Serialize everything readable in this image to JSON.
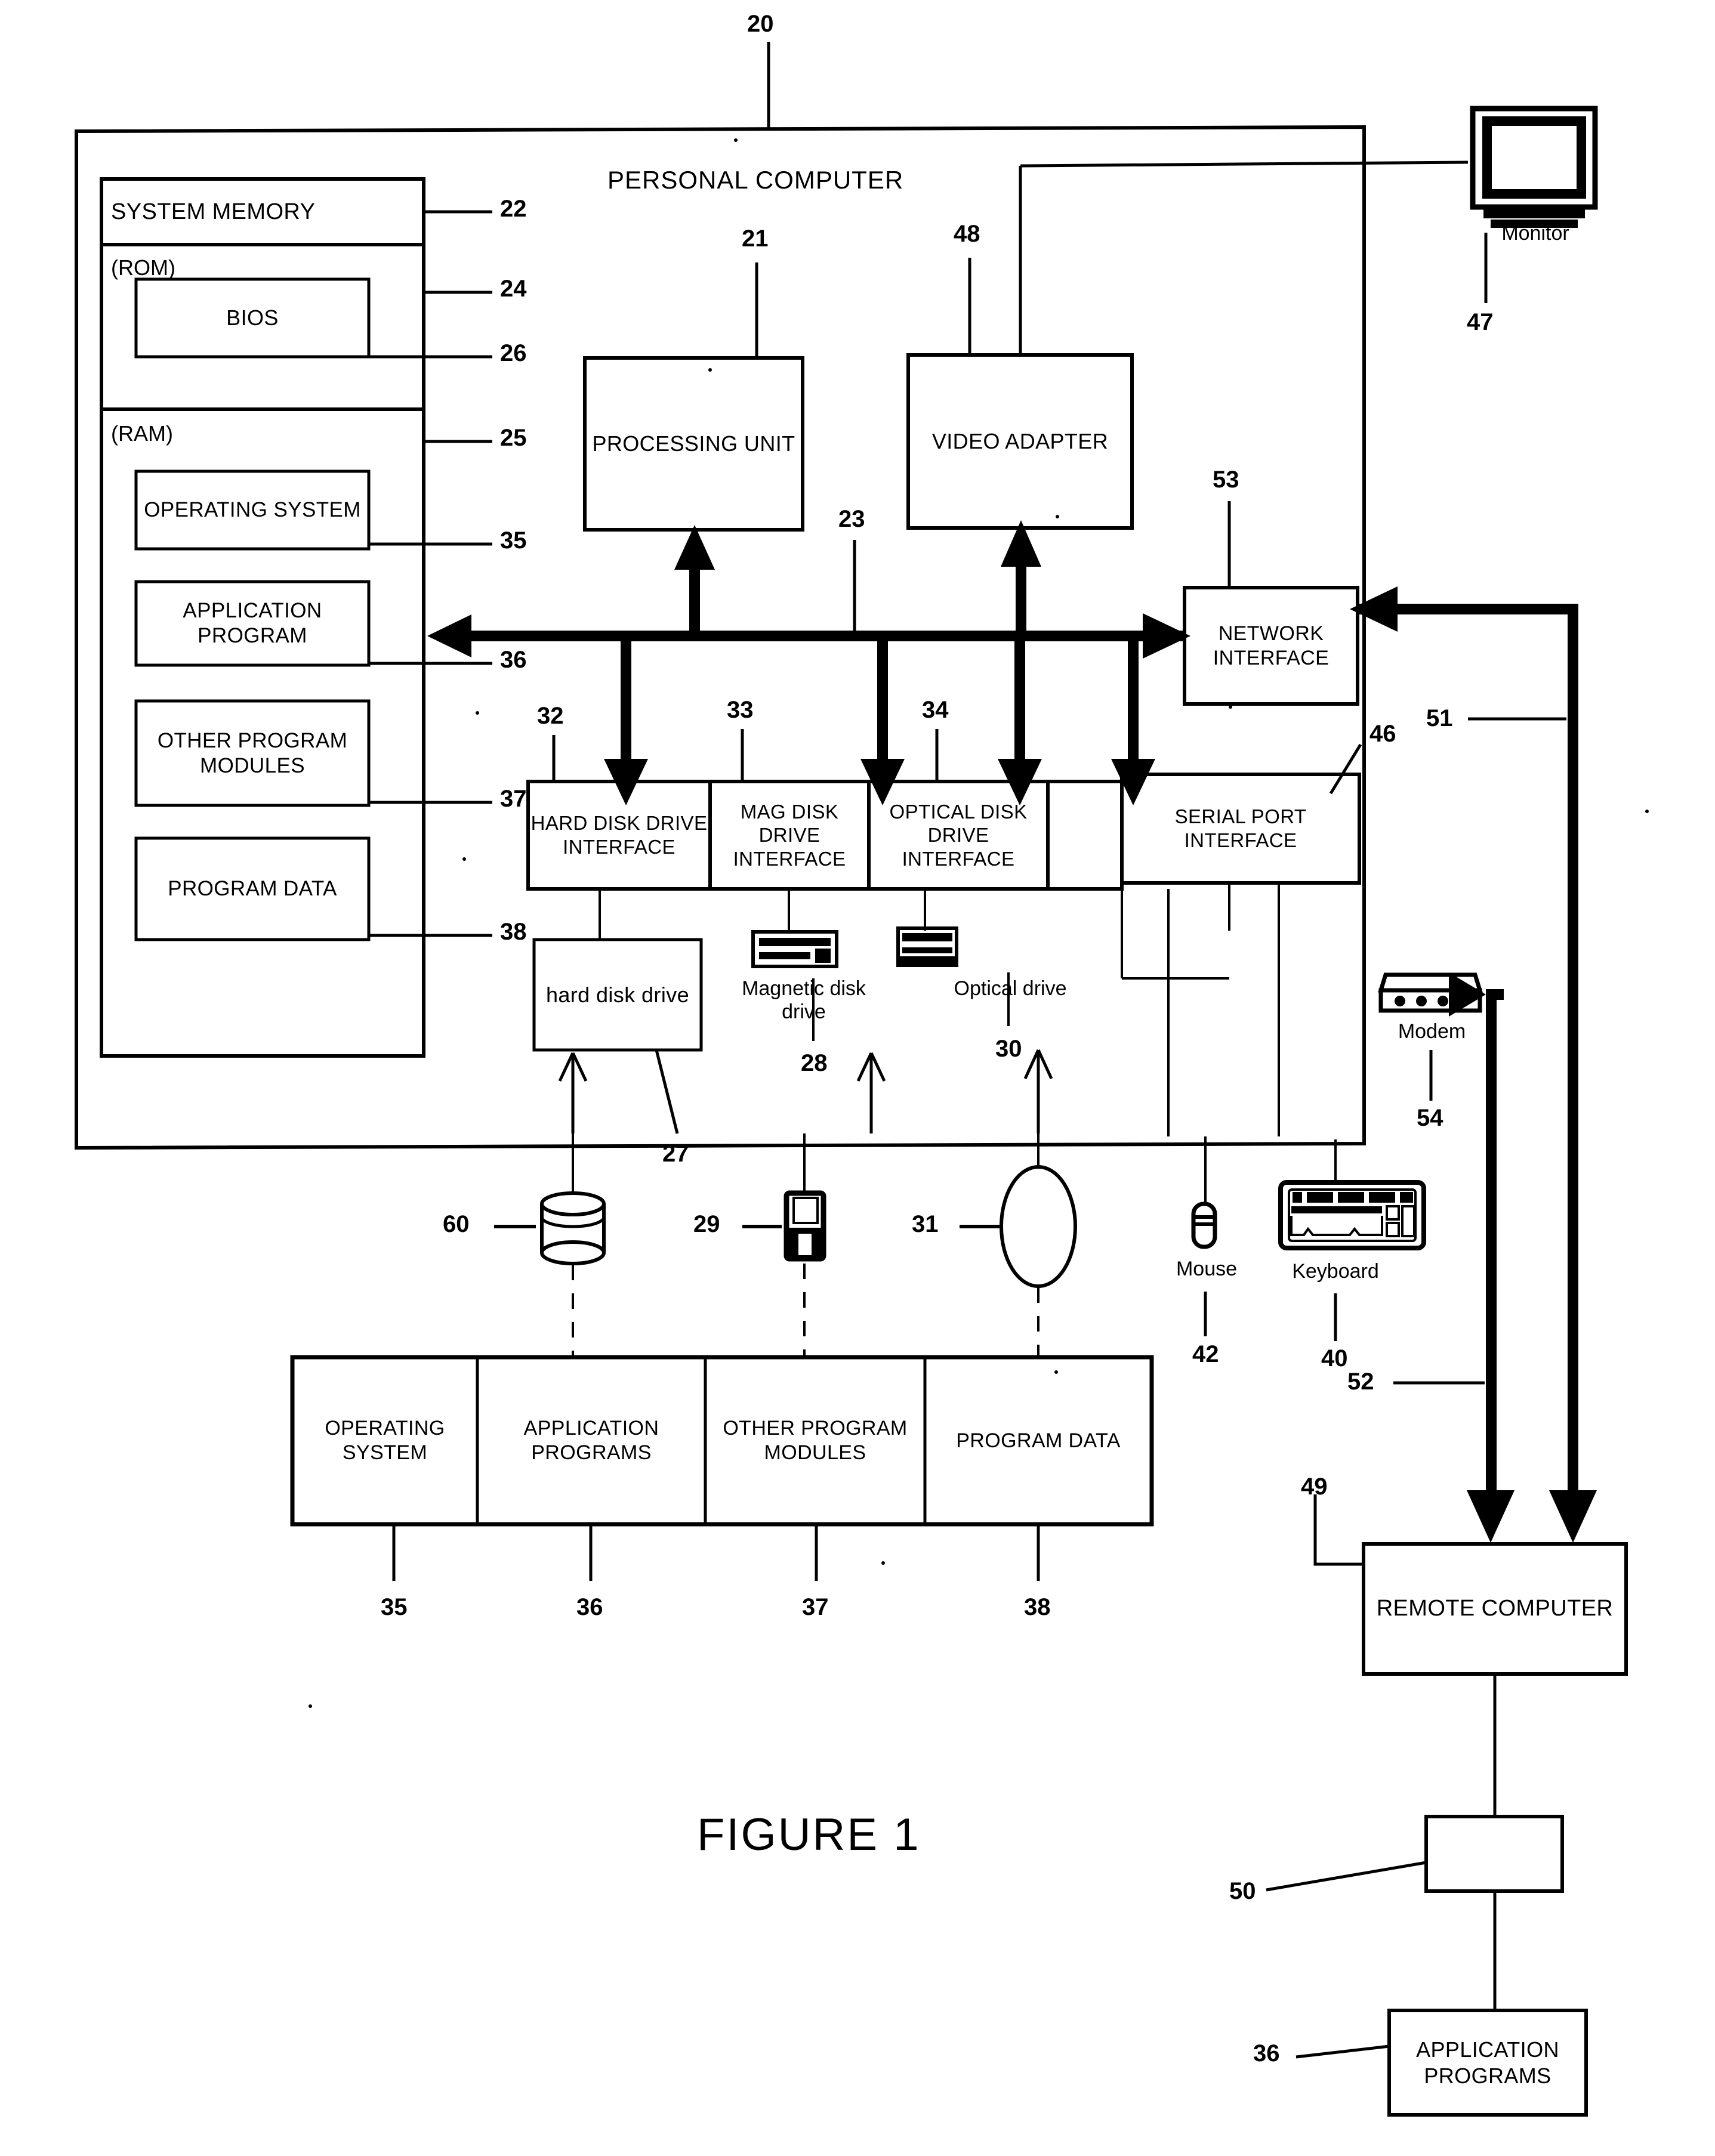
{
  "figure": {
    "caption": "FIGURE 1",
    "system_ref": "20",
    "title": "PERSONAL COMPUTER"
  },
  "memory": {
    "title": "SYSTEM MEMORY",
    "title_ref": "22",
    "rom_label": "(ROM)",
    "rom_ref": "24",
    "bios_label": "BIOS",
    "bios_ref": "26",
    "ram_label": "(RAM)",
    "ram_ref": "25",
    "items": [
      {
        "label": "OPERATING\nSYSTEM",
        "ref": "35"
      },
      {
        "label": "APPLICATION\nPROGRAM",
        "ref": "36"
      },
      {
        "label": "OTHER\nPROGRAM\nMODULES",
        "ref": "37"
      },
      {
        "label": "PROGRAM\nDATA",
        "ref": "38"
      }
    ]
  },
  "core": {
    "processing_unit": {
      "label": "PROCESSING\nUNIT",
      "ref": "21"
    },
    "video_adapter": {
      "label": "VIDEO\nADAPTER",
      "ref": "48"
    },
    "network_interface": {
      "label": "NETWORK\nINTERFACE",
      "ref": "53"
    },
    "bus_ref": "23"
  },
  "interfaces": [
    {
      "label": "HARD DISK\nDRIVE\nINTERFACE",
      "ref": "32"
    },
    {
      "label": "MAG DISK\nDRIVE\nINTERFACE",
      "ref": "33"
    },
    {
      "label": "OPTICAL DISK\nDRIVE\nINTERFACE",
      "ref": "34"
    },
    {
      "label": "SERIAL PORT\nINTERFACE",
      "ref": "46"
    }
  ],
  "drives": {
    "hard_disk": {
      "label": "hard disk\ndrive",
      "ref": "27"
    },
    "magnetic_disk": {
      "label": "Magnetic disk\ndrive",
      "ref": "28"
    },
    "optical": {
      "label": "Optical drive",
      "ref": "30"
    }
  },
  "media": {
    "hard_disk_platter_ref": "60",
    "floppy_ref": "29",
    "optical_disc_ref": "31"
  },
  "peripherals": {
    "monitor": {
      "label": "Monitor",
      "ref": "47"
    },
    "keyboard": {
      "label": "Keyboard",
      "ref": "40"
    },
    "mouse": {
      "label": "Mouse",
      "ref": "42"
    },
    "modem": {
      "label": "Modem",
      "ref": "54"
    }
  },
  "storage_contents": {
    "cells": [
      {
        "label": "OPERATING\nSYSTEM",
        "ref": "35"
      },
      {
        "label": "APPLICATION\nPROGRAMS",
        "ref": "36"
      },
      {
        "label": "OTHER\nPROGRAM\nMODULES",
        "ref": "37"
      },
      {
        "label": "PROGRAM\nDATA",
        "ref": "38"
      }
    ]
  },
  "remote": {
    "computer": {
      "label": "REMOTE\nCOMPUTER",
      "ref": "49"
    },
    "memory_ref": "50",
    "application_programs": {
      "label": "APPLICATION\nPROGRAMS",
      "ref": "36"
    }
  },
  "networks": {
    "wan_ref": "51",
    "lan_ref": "52"
  },
  "colors": {
    "ink": "#000000",
    "paper": "#ffffff"
  }
}
